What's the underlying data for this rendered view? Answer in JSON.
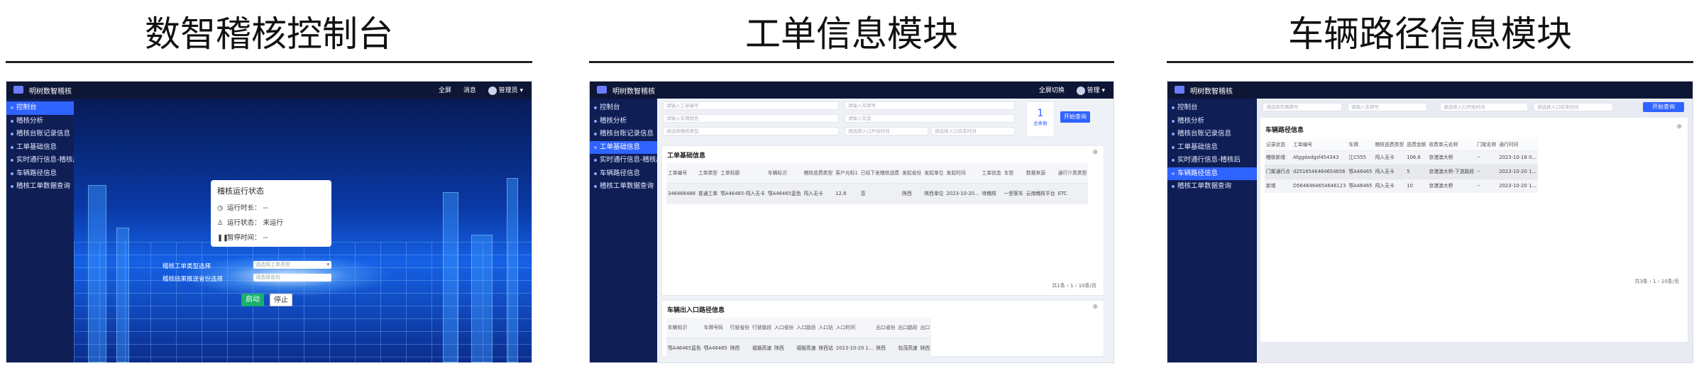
{
  "panels": {
    "p1": {
      "title": "数智稽核控制台",
      "app_name": "明树数智稽核",
      "top_right": {
        "fullscreen": "全屏",
        "notify": "消息",
        "user": "管理员"
      },
      "sidebar": [
        "控制台",
        "稽核分析",
        "稽核台账记录信息",
        "工单基础信息",
        "实时通行信息-稽核后",
        "车辆路径信息",
        "稽核工单数据查询"
      ],
      "status_card": {
        "title": "稽核运行状态",
        "rows": [
          {
            "icon": "clock-icon",
            "label": "运行时长：",
            "value": "--"
          },
          {
            "icon": "run-icon",
            "label": "运行状态：",
            "value": "未运行"
          },
          {
            "icon": "pause-icon",
            "label": "暂停时间：",
            "value": "--"
          }
        ]
      },
      "form": {
        "label_1": "稽核工单类型选择",
        "label_2": "稽核结果推送省份选择",
        "placeholder_1": "请选择工单类型",
        "placeholder_2": "请选择省份"
      },
      "buttons": {
        "start": "启动",
        "stop": "停止"
      },
      "colors": {
        "accent": "#2f63ff",
        "start": "#1aaf6c"
      }
    },
    "p2": {
      "title": "工单信息模块",
      "app_name": "明树数智稽核",
      "top_right": {
        "fullscreen": "全屏切换",
        "user": "管理"
      },
      "sidebar": [
        "控制台",
        "稽核分析",
        "稽核台账记录信息",
        "工单基础信息",
        "实时通行信息-稽核后",
        "车辆路径信息",
        "稽核工单数据查询"
      ],
      "filters": [
        "请输入工单编号",
        "请输入车牌号",
        "请输入车牌颜色",
        "请输入车型",
        "请选择稽核类型",
        "请选择入口开始时间",
        "请选择入口结束时间"
      ],
      "stat": {
        "count": "1",
        "label": "总条数"
      },
      "search_button": "开始查询",
      "table1": {
        "title": "工单基础信息",
        "columns": [
          "工单编号",
          "工单类型",
          "工单标题",
          "车辆标识",
          "稽核逃费类型",
          "客户光标1",
          "已经下发稽核逃费",
          "发起省份",
          "发起单位",
          "发起时间",
          "工单状态",
          "车型",
          "数据来源",
          "通行介质类型"
        ],
        "rows": [
          [
            "346466488",
            "普通工单",
            "鄂A46465-闯入无卡",
            "鄂A46465蓝色",
            "闯入无卡",
            "12.8",
            "否",
            "陕西",
            "陕西单位",
            "2023-10-20...",
            "待稽核",
            "一型客车",
            "云南稽核平台",
            "ETC"
          ]
        ]
      },
      "pager1": "共1条   ‹  1  ›   10条/页",
      "table2": {
        "title": "车辆出入口路径信息",
        "columns": [
          "车辆标识",
          "车牌号码",
          "行驶省份",
          "行驶路段",
          "入口省份",
          "入口路段",
          "入口站",
          "入口时间",
          "出口省份",
          "出口路段",
          "出口"
        ],
        "rows": [
          [
            "鄂A46465蓝色",
            "鄂A46465",
            "陕西",
            "福银高速",
            "陕西",
            "福银高速",
            "陕西站",
            "2023-10-20 1...",
            "陕西",
            "包茂高速",
            "陕西"
          ]
        ]
      }
    },
    "p3": {
      "title": "车辆路径信息模块",
      "app_name": "明树数智稽核",
      "sidebar": [
        "控制台",
        "稽核分析",
        "稽核台账记录信息",
        "工单基础信息",
        "实时通行信息-稽核后",
        "车辆路径信息",
        "稽核工单数据查询"
      ],
      "filters": [
        "请选择车辆牌号",
        "请输入车牌号",
        "请选择入口开始时间",
        "请选择入口结束时间"
      ],
      "search_button": "开始查询",
      "table": {
        "title": "车辆路径信息",
        "columns": [
          "记录状态",
          "工单编号",
          "车牌",
          "稽核逃费类型",
          "逃费金额",
          "收费单元名称",
          "门架名称",
          "通行时间"
        ],
        "rows": [
          [
            "稽核新增",
            "Afggdadgsf454343",
            "江C555",
            "闯入无卡",
            "106.6",
            "京港澳大桥",
            "--",
            "2023-10-18 0..."
          ],
          [
            "门架通行点",
            "d2516546464654656",
            "鄂A46465",
            "闯入无卡",
            "5",
            "京港澳大桥-下游路段",
            "--",
            "2023-10-20 1..."
          ],
          [
            "新增",
            "D5646464654646123",
            "鄂A46465",
            "闯入无卡",
            "10",
            "京港澳大桥",
            "--",
            "2023-10-20 1..."
          ]
        ]
      },
      "pager": "共3条   ‹  1  ›   10条/页"
    }
  }
}
